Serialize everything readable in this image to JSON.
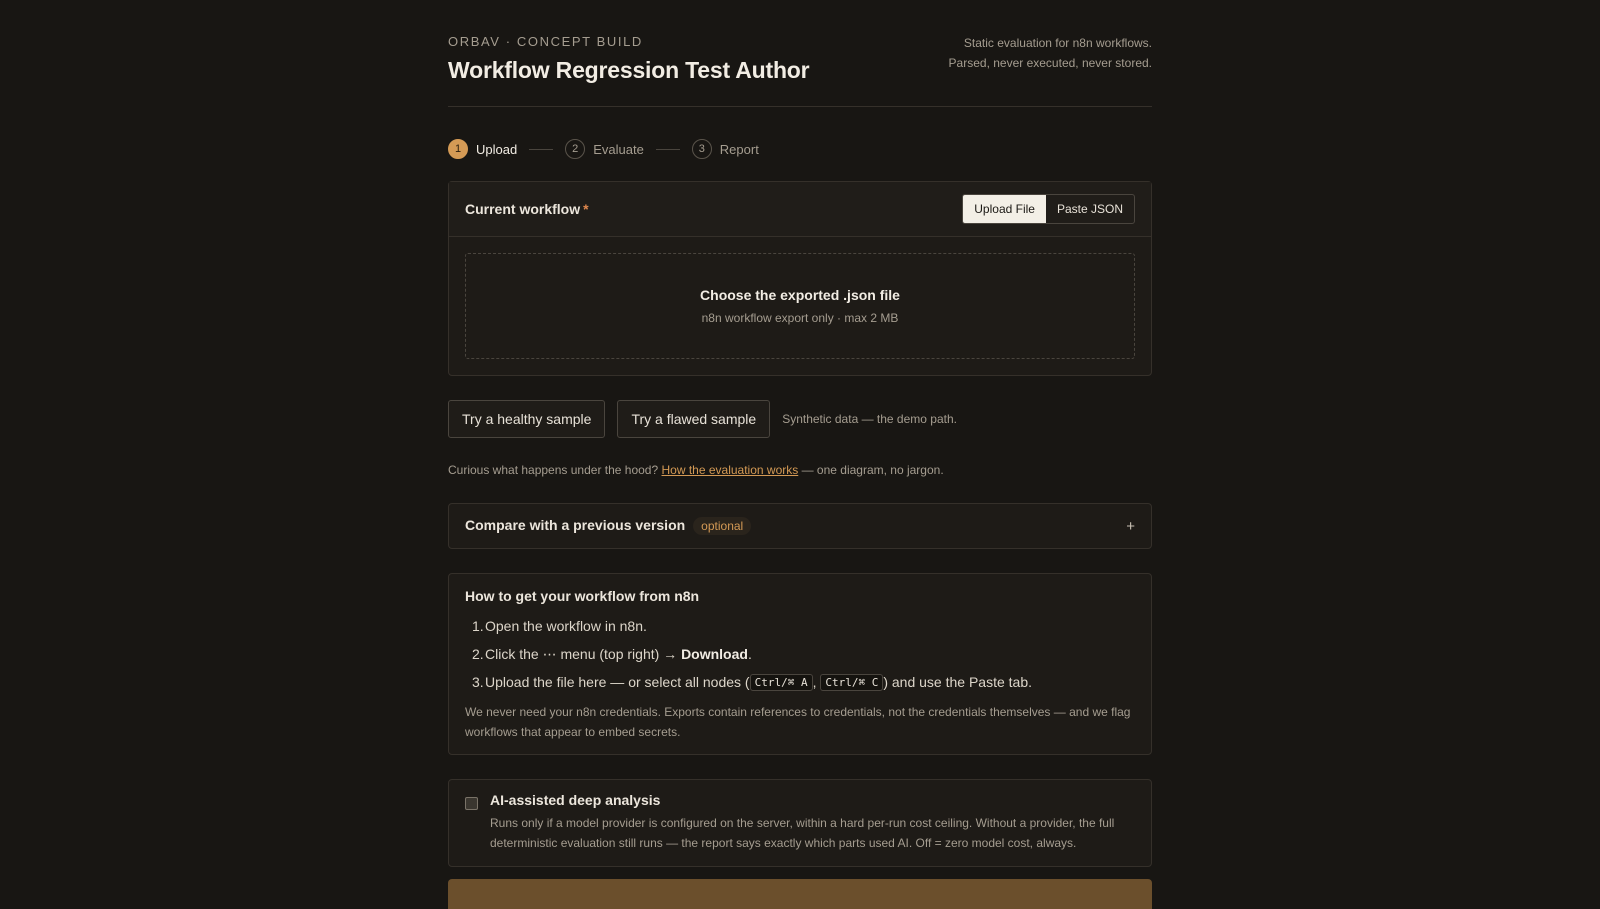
{
  "header": {
    "eyebrow": "ORBAV · CONCEPT BUILD",
    "title": "Workflow Regression Test Author",
    "tagline_line1": "Static evaluation for n8n workflows.",
    "tagline_line2": "Parsed, never executed, never stored."
  },
  "stepper": {
    "steps": [
      {
        "num": "1",
        "label": "Upload"
      },
      {
        "num": "2",
        "label": "Evaluate"
      },
      {
        "num": "3",
        "label": "Report"
      }
    ],
    "active": "1"
  },
  "upload": {
    "label": "Current workflow",
    "required_mark": "*",
    "tabs": [
      "Upload File",
      "Paste JSON"
    ],
    "selected_tab": "Upload File",
    "dropzone_title": "Choose the exported .json file",
    "dropzone_sub": "n8n workflow export only · max 2 MB"
  },
  "samples": {
    "healthy": "Try a healthy sample",
    "flawed": "Try a flawed sample",
    "note": "Synthetic data — the demo path."
  },
  "curious": {
    "prefix": "Curious what happens under the hood?",
    "link": "How the evaluation works",
    "suffix": "— one diagram, no jargon."
  },
  "compare": {
    "label": "Compare with a previous version",
    "badge": "optional",
    "toggle": "+"
  },
  "howto": {
    "title": "How to get your workflow from n8n",
    "step1": "Open the workflow in n8n.",
    "step2_pre": "Click the ⋯ menu (top right) →",
    "step2_bold": "Download",
    "step2_post": ".",
    "step3_pre": "Upload the file here — or select all nodes (",
    "kbd1": "Ctrl/⌘ A",
    "sep": ",",
    "kbd2": "Ctrl/⌘ C",
    "step3_post": ") and use the Paste tab.",
    "note": "We never need your n8n credentials. Exports contain references to credentials, not the credentials themselves — and we flag workflows that appear to embed secrets."
  },
  "ai": {
    "title": "AI-assisted deep analysis",
    "checked": false,
    "desc": "Runs only if a model provider is configured on the server, within a hard per-run cost ceiling. Without a provider, the full deterministic evaluation still runs — the report says exactly which parts used AI. Off = zero model cost, always."
  },
  "colors": {
    "accent": "#d49a55",
    "background": "#181613",
    "card": "#1e1b17"
  }
}
